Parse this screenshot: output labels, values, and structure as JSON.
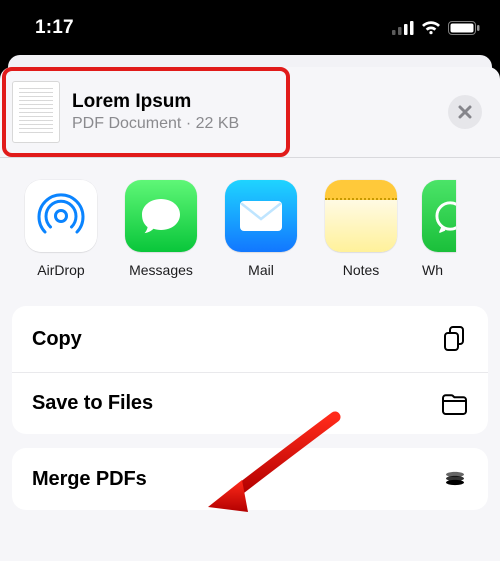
{
  "statusbar": {
    "time": "1:17"
  },
  "share": {
    "document": {
      "title": "Lorem Ipsum",
      "type": "PDF Document",
      "size": "22 KB"
    },
    "apps": [
      {
        "id": "airdrop",
        "label": "AirDrop"
      },
      {
        "id": "messages",
        "label": "Messages"
      },
      {
        "id": "mail",
        "label": "Mail"
      },
      {
        "id": "notes",
        "label": "Notes"
      },
      {
        "id": "whatsapp",
        "label": "Wh"
      }
    ],
    "actions_group1": [
      {
        "id": "copy",
        "label": "Copy"
      },
      {
        "id": "files",
        "label": "Save to Files"
      }
    ],
    "actions_group2": [
      {
        "id": "merge",
        "label": "Merge PDFs"
      }
    ]
  }
}
